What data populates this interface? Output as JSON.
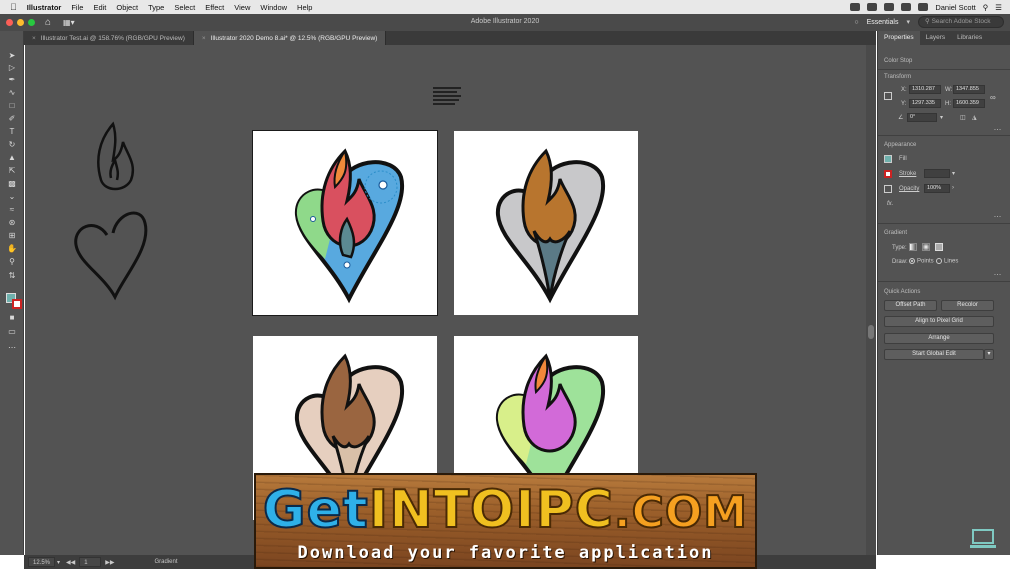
{
  "menubar": {
    "app_name": "Illustrator",
    "items": [
      "File",
      "Edit",
      "Object",
      "Type",
      "Select",
      "Effect",
      "View",
      "Window",
      "Help"
    ],
    "user": "Daniel Scott"
  },
  "titlebar": {
    "window_title": "Adobe Illustrator 2020",
    "workspace": "Essentials",
    "search_placeholder": "Search Adobe Stock"
  },
  "tabs": [
    {
      "label": "Illustrator Test.ai @ 158.76% (RGB/GPU Preview)"
    },
    {
      "label": "Illustrator 2020 Demo 8.ai* @ 12.5% (RGB/GPU Preview)"
    }
  ],
  "panel": {
    "tabs": [
      "Properties",
      "Layers",
      "Libraries"
    ],
    "selection_label": "Color Stop",
    "transform": {
      "title": "Transform",
      "x_label": "X:",
      "x": "1310.287",
      "y_label": "Y:",
      "y": "1297.335",
      "w_label": "W:",
      "w": "1347.855",
      "h_label": "H:",
      "h": "1600.359",
      "angle": "0°"
    },
    "appearance": {
      "title": "Appearance",
      "fill_label": "Fill",
      "stroke_label": "Stroke",
      "opacity_label": "Opacity",
      "opacity": "100%",
      "fx_label": "fx."
    },
    "gradient": {
      "title": "Gradient",
      "type_label": "Type:",
      "draw_label": "Draw:",
      "points_label": "Points",
      "lines_label": "Lines"
    },
    "quick_actions": {
      "title": "Quick Actions",
      "offset_path": "Offset Path",
      "recolor": "Recolor",
      "align_pixel": "Align to Pixel Grid",
      "arrange": "Arrange",
      "global_edit": "Start Global Edit"
    }
  },
  "statusbar": {
    "zoom": "12.5%",
    "artboard": "1",
    "tool": "Gradient"
  },
  "watermark": {
    "logo_part1": "Get",
    "logo_part2": "INTO",
    "logo_part3": "IPC",
    "logo_part4": ".COM",
    "tagline": "Download your favorite application"
  },
  "colors": {
    "fill_swatch": "#6fb1ad",
    "ui_dark": "#535353"
  }
}
